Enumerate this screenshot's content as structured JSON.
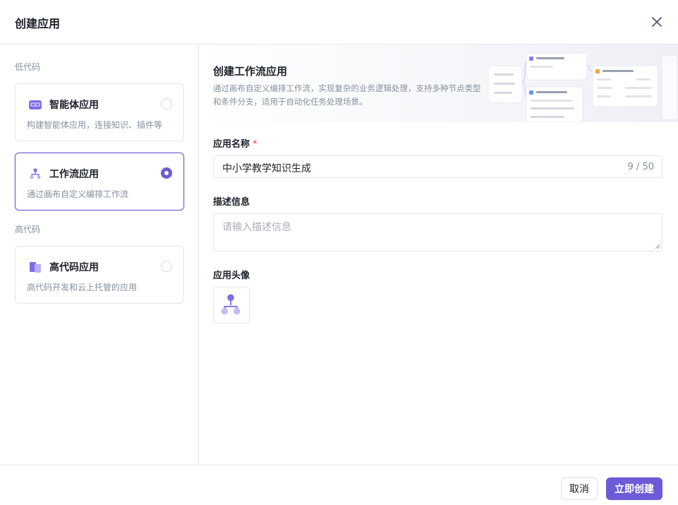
{
  "dialog": {
    "title": "创建应用",
    "close_icon": "close-icon"
  },
  "sidebar": {
    "low_code_label": "低代码",
    "high_code_label": "高代码",
    "cards": [
      {
        "title": "智能体应用",
        "desc": "构建智能体应用，连接知识、插件等",
        "icon": "agent-icon",
        "selected": false
      },
      {
        "title": "工作流应用",
        "desc": "通过画布自定义编排工作流",
        "icon": "workflow-icon",
        "selected": true
      },
      {
        "title": "高代码应用",
        "desc": "高代码开发和云上托管的应用",
        "icon": "code-app-icon",
        "selected": false
      }
    ]
  },
  "banner": {
    "title": "创建工作流应用",
    "desc": "通过画布自定义编排工作流，实现复杂的业务逻辑处理，支持多种节点类型和条件分支，适用于自动化任务处理场景。"
  },
  "form": {
    "name_label": "应用名称",
    "required_mark": "*",
    "name_value": "中小学教学知识生成",
    "name_counter": "9 / 50",
    "desc_label": "描述信息",
    "desc_placeholder": "请输入描述信息",
    "avatar_label": "应用头像"
  },
  "footer": {
    "cancel_label": "取消",
    "create_label": "立即创建"
  },
  "colors": {
    "accent": "#6b5bd6",
    "border": "#e5e6eb",
    "muted_text": "#86909c",
    "required": "#f53f3f"
  }
}
